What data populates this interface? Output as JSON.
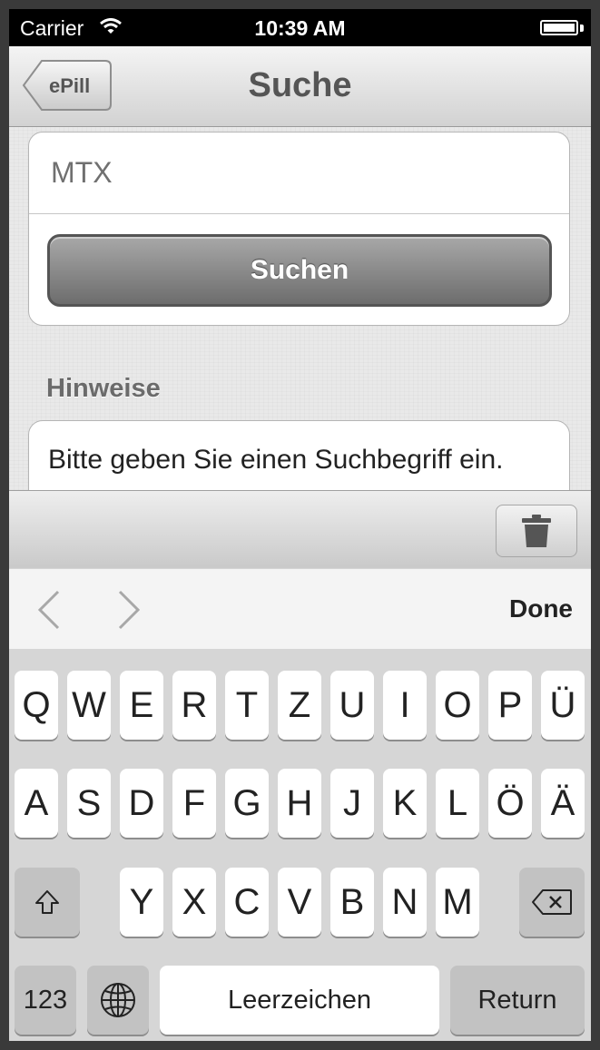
{
  "status_bar": {
    "carrier": "Carrier",
    "time": "10:39 AM"
  },
  "nav": {
    "back_label": "ePill",
    "title": "Suche"
  },
  "search": {
    "value": "",
    "placeholder": "MTX",
    "button_label": "Suchen"
  },
  "hints": {
    "header": "Hinweise",
    "text": "Bitte geben Sie einen Suchbegriff ein."
  },
  "toolbar": {
    "trash_icon": "trash-icon"
  },
  "accessory": {
    "done_label": "Done"
  },
  "keyboard": {
    "row1": [
      "Q",
      "W",
      "E",
      "R",
      "T",
      "Z",
      "U",
      "I",
      "O",
      "P",
      "Ü"
    ],
    "row2": [
      "A",
      "S",
      "D",
      "F",
      "G",
      "H",
      "J",
      "K",
      "L",
      "Ö",
      "Ä"
    ],
    "row3": [
      "Y",
      "X",
      "C",
      "V",
      "B",
      "N",
      "M"
    ],
    "numbers_label": "123",
    "space_label": "Leerzeichen",
    "return_label": "Return"
  }
}
